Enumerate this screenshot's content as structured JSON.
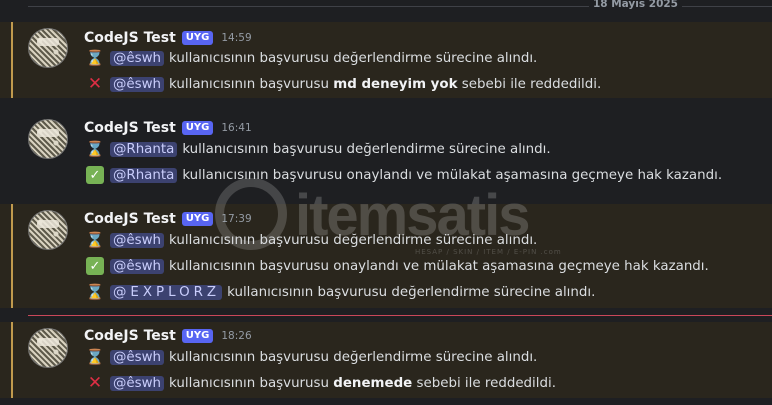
{
  "date_divider": "18 Mayıs 2025",
  "watermark": {
    "brand": "itemsatis",
    "tagline": "HESAP / SKIN / ITEM / E-PIN .com"
  },
  "messages": [
    {
      "author": "CodeJS Test",
      "badge": "UYG",
      "time": "14:59",
      "lines": [
        {
          "icon": "hourglass-icon",
          "mention": "@êswh",
          "pre": "kullanıcısının başvurusu değerlendirme sürecine alındı.",
          "bold": "",
          "post": ""
        },
        {
          "icon": "cross-icon",
          "mention": "@êswh",
          "pre": "kullanıcısının başvurusu ",
          "bold": "md deneyim yok",
          "post": " sebebi ile reddedildi."
        }
      ]
    },
    {
      "author": "CodeJS Test",
      "badge": "UYG",
      "time": "16:41",
      "lines": [
        {
          "icon": "hourglass-icon",
          "mention": "@Rhanta",
          "pre": "kullanıcısının başvurusu değerlendirme sürecine alındı.",
          "bold": "",
          "post": ""
        },
        {
          "icon": "check-icon",
          "mention": "@Rhanta",
          "pre": "kullanıcısının başvurusu onaylandı ve mülakat aşamasına geçmeye hak kazandı.",
          "bold": "",
          "post": ""
        }
      ]
    },
    {
      "author": "CodeJS Test",
      "badge": "UYG",
      "time": "17:39",
      "lines": [
        {
          "icon": "hourglass-icon",
          "mention": "@êswh",
          "pre": "kullanıcısının başvurusu değerlendirme sürecine alındı.",
          "bold": "",
          "post": ""
        },
        {
          "icon": "check-icon",
          "mention": "@êswh",
          "pre": "kullanıcısının başvurusu onaylandı ve mülakat aşamasına geçmeye hak kazandı.",
          "bold": "",
          "post": ""
        },
        {
          "icon": "hourglass-icon",
          "mention": "@EXPLORZ",
          "pre": "kullanıcısının başvurusu değerlendirme sürecine alındı.",
          "bold": "",
          "post": ""
        }
      ]
    },
    {
      "author": "CodeJS Test",
      "badge": "UYG",
      "time": "18:26",
      "lines": [
        {
          "icon": "hourglass-icon",
          "mention": "@êswh",
          "pre": "kullanıcısının başvurusu değerlendirme sürecine alındı.",
          "bold": "",
          "post": ""
        },
        {
          "icon": "cross-icon",
          "mention": "@êswh",
          "pre": "kullanıcısının başvurusu ",
          "bold": "denemede",
          "post": " sebebi ile reddedildi."
        }
      ]
    }
  ],
  "colors": {
    "mention_bg": "#3c4270",
    "badge_bg": "#5865f2",
    "highlight_bar": "#c09a4e",
    "new_divider": "#c9475a"
  }
}
